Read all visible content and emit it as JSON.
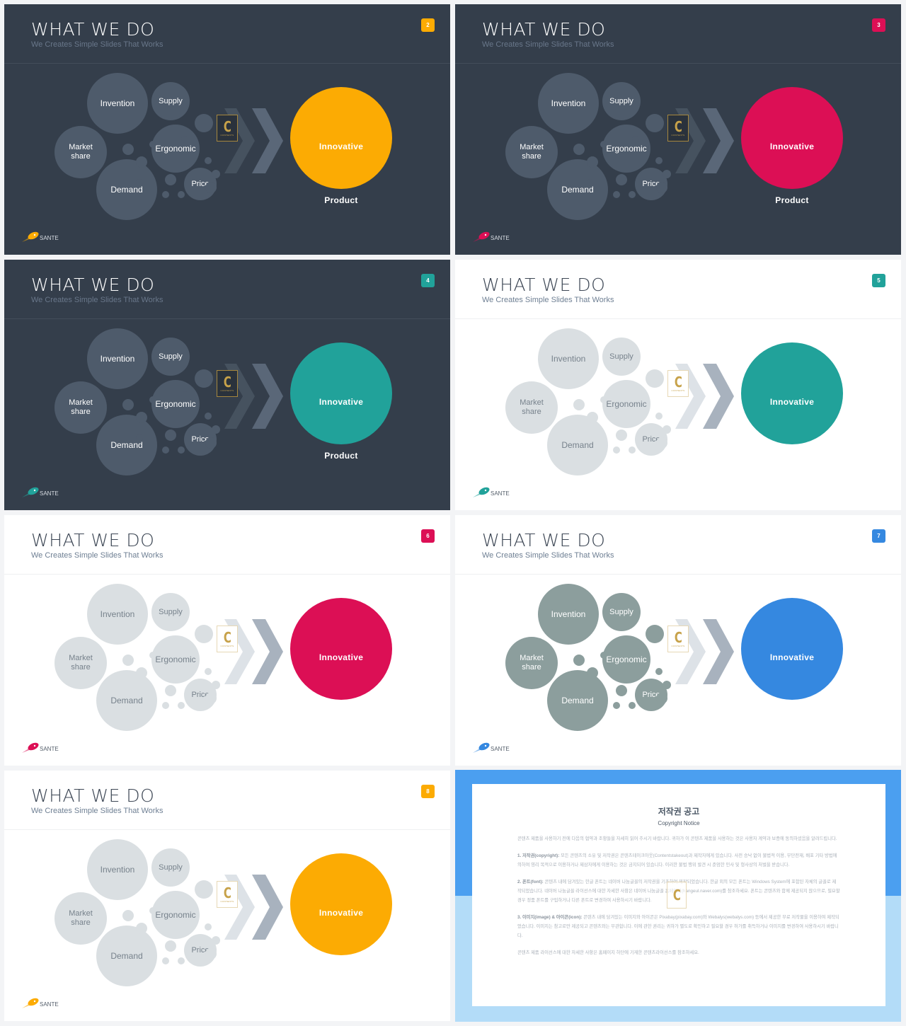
{
  "deck": {
    "slide_title": "WHAT WE DO",
    "slide_subtitle": "We Creates Simple Slides That Works",
    "brand_name": "SANTE",
    "watermark_letter": "C",
    "watermark_text": "CONTENTS",
    "bubbles": {
      "invention": "Invention",
      "supply": "Supply",
      "market_share_line1": "Market",
      "market_share_line2": "share",
      "ergonomic": "Ergonomic",
      "demand": "Demand",
      "price": "Price"
    },
    "product_line1": "Innovative",
    "product_line2": "Product"
  },
  "slides": [
    {
      "page": "2",
      "theme": "dark",
      "accent": "#fcab03",
      "bubble_color": "#4e5b6b",
      "bubble_text": "#ffffff",
      "chevron_1": "#46525f",
      "chevron_2": "#5a6778"
    },
    {
      "page": "3",
      "theme": "dark",
      "accent": "#dc0f55",
      "bubble_color": "#4e5b6b",
      "bubble_text": "#ffffff",
      "chevron_1": "#46525f",
      "chevron_2": "#5a6778"
    },
    {
      "page": "4",
      "theme": "dark",
      "accent": "#21a29a",
      "bubble_color": "#4e5b6b",
      "bubble_text": "#ffffff",
      "chevron_1": "#46525f",
      "chevron_2": "#5a6778"
    },
    {
      "page": "5",
      "theme": "light",
      "accent": "#21a29a",
      "bubble_color": "#dadfe2",
      "bubble_text": "#77828c",
      "chevron_1": "#dde2e7",
      "chevron_2": "#a8b2be"
    },
    {
      "page": "6",
      "theme": "light",
      "accent": "#dc0f55",
      "bubble_color": "#dadfe2",
      "bubble_text": "#77828c",
      "chevron_1": "#dde2e7",
      "chevron_2": "#a8b2be"
    },
    {
      "page": "7",
      "theme": "light",
      "accent": "#3588e0",
      "bubble_color": "#8c9e9d",
      "bubble_text": "#ffffff",
      "chevron_1": "#dde2e7",
      "chevron_2": "#a8b2be"
    },
    {
      "page": "8",
      "theme": "light",
      "accent": "#fcab03",
      "bubble_color": "#dadfe2",
      "bubble_text": "#77828c",
      "chevron_1": "#dde2e7",
      "chevron_2": "#a8b2be"
    }
  ],
  "copyright": {
    "title": "저작권 공고",
    "subtitle": "Copyright Notice",
    "intro": "콘텐츠 제품을 사용하기 전에 다음의 협약과 조항들을 자세히 읽어 주시기 바랍니다. 귀하가 이 콘텐츠 제품을 사용하는 것은 사용자 계약과 보증에 동의하셨음을 알려드립니다.",
    "sections": [
      {
        "heading": "1. 저작권(copyright):",
        "body": " 모든 콘텐츠의 소유 및 저작권은 콘텐츠테이크아웃(Contentstakeout)과 제작자에게 있습니다. 사전 승낙 없이 불법적 이용, 무단전재, 배포 기타 방법에 의하여 영리 목적으로 이용하거나 제삼자에게 이용하는 것은 금지되어 있습니다. 이러한 불법 행위 발견 시 준엄한 민사 및 형사상의 처벌을 받습니다."
      },
      {
        "heading": "2. 폰트(font):",
        "body": " 콘텐츠 내에 담겨있는 한글 폰트는 네이버 나눔글꼴의 저작권을 기초하여 제작되었습니다. 한글 외의 모든 폰트는 Windows System에 포함된 자체의 글꼴로 제작되었습니다. 네이버 나눔글꼴 라이선스에 대한 자세한 사항은 네이버 나눔글꼴 홈페이지(hangeul.naver.com)를 참조하세요. 폰트는 콘텐츠와 함께 제공되지 않으므로, 필요할 경우 정품 폰트를 구입하거나 다른 폰트로 변경하여 사용하시기 바랍니다."
      },
      {
        "heading": "3. 이미지(image) & 아이콘(icon):",
        "body": " 콘텐츠 내에 담겨있는 이미지와 아이콘은 Pixabay(pixabay.com)와 Webalys(webalys.com) 등에서 제공한 무료 저작물을 이용하여 제작되었습니다. 이미지는 참고로만 제공되고 콘텐츠와는 무관합니다. 이에 관한 권리는 귀하가 별도로 확인하고 필요할 경우 허가를 취득하거나 이미지를 변경하여 사용하시기 바랍니다."
      }
    ],
    "footer": "콘텐츠 제품 라이선스에 대한 자세한 사항은 홈페이지 하단에 기재한 콘텐츠라이선스를 참조하세요.",
    "watermark_letter": "C",
    "frame_top_color": "#4b9ff0",
    "frame_bottom_color": "#b3dcf8"
  }
}
